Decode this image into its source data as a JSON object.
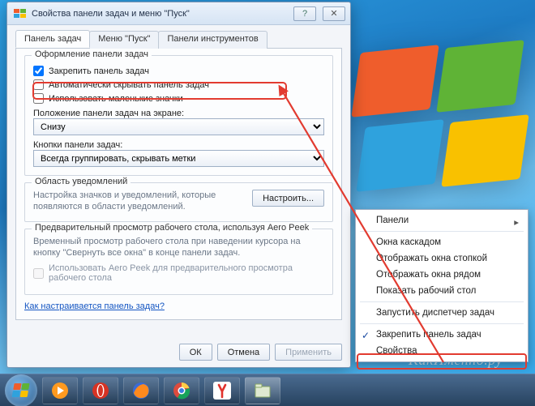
{
  "dialog": {
    "title": "Свойства панели задач и меню \"Пуск\"",
    "tabs": [
      "Панель задач",
      "Меню \"Пуск\"",
      "Панели инструментов"
    ],
    "group_appearance": {
      "legend": "Оформление панели задач",
      "lock": "Закрепить панель задач",
      "autohide": "Автоматически скрывать панель задач",
      "smallicons": "Использовать маленькие значки",
      "poslabel": "Положение панели задач на экране:",
      "posvalue": "Снизу",
      "btnslabel": "Кнопки панели задач:",
      "btnsvalue": "Всегда группировать, скрывать метки"
    },
    "group_notif": {
      "legend": "Область уведомлений",
      "desc": "Настройка значков и уведомлений, которые появляются в области уведомлений.",
      "btn": "Настроить..."
    },
    "group_peek": {
      "legend": "Предварительный просмотр рабочего стола, используя Aero Peek",
      "desc": "Временный просмотр рабочего стола при наведении курсора на кнопку \"Свернуть все окна\" в конце панели задач.",
      "cb": "Использовать Aero Peek для предварительного просмотра рабочего стола"
    },
    "helplink": "Как настраивается панель задач?",
    "buttons": {
      "ok": "ОК",
      "cancel": "Отмена",
      "apply": "Применить"
    }
  },
  "context_menu": {
    "items": [
      "Панели",
      "Окна каскадом",
      "Отображать окна стопкой",
      "Отображать окна рядом",
      "Показать рабочий стол",
      "Запустить диспетчер задач",
      "Закрепить панель задач",
      "Свойства"
    ]
  },
  "watermark": "КакИменно.ру"
}
